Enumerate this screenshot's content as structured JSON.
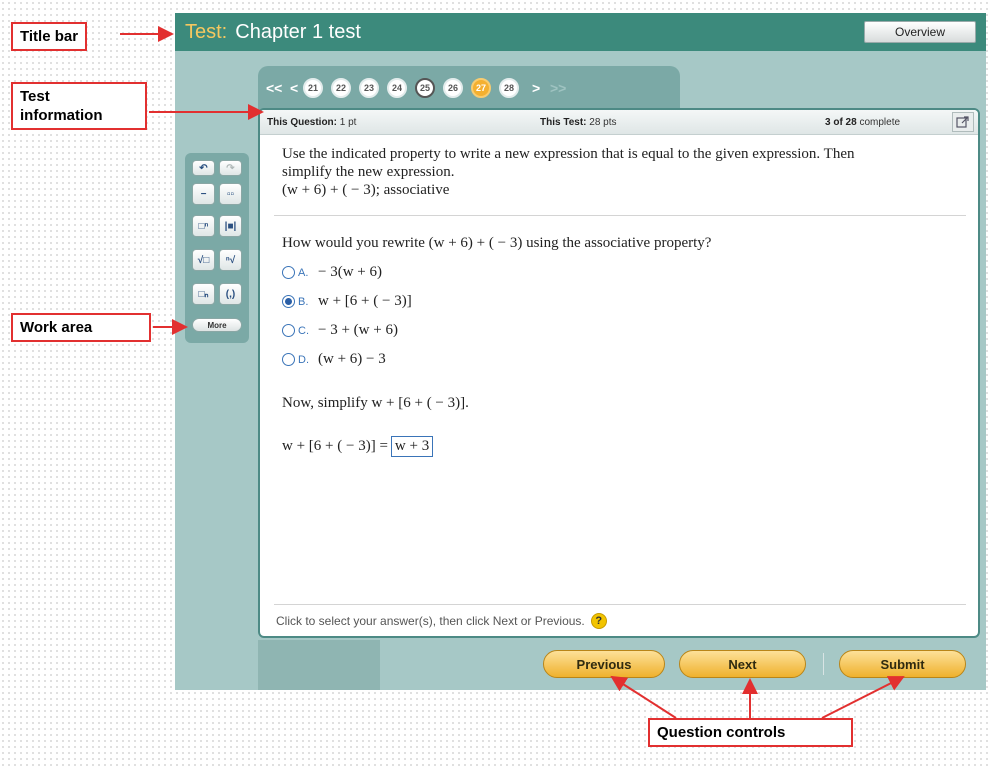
{
  "title_bar": {
    "prefix": "Test:",
    "name": "Chapter 1 test",
    "overview_label": "Overview"
  },
  "question_nav": {
    "first_label": "<<",
    "prev_label": "<",
    "next_label": ">",
    "last_label": ">>",
    "numbers": [
      "21",
      "22",
      "23",
      "24",
      "25",
      "26",
      "27",
      "28"
    ],
    "current": "25",
    "highlighted": "27"
  },
  "test_info": {
    "question_label": "This Question:",
    "question_value": "1 pt",
    "test_label": "This Test:",
    "test_value": "28 pts",
    "progress_strong": "3 of 28",
    "progress_suffix": "complete"
  },
  "question": {
    "prompt_line1": "Use the indicated property to write a new expression that is equal to the given expression. Then",
    "prompt_line2": "simplify the new expression.",
    "expression": "(w + 6) + ( − 3); associative",
    "ask": "How would you rewrite (w + 6) + ( − 3) using the associative property?",
    "options": [
      {
        "letter": "A.",
        "text": "− 3(w + 6)",
        "selected": false
      },
      {
        "letter": "B.",
        "text": "w + [6 + ( − 3)]",
        "selected": true
      },
      {
        "letter": "C.",
        "text": "− 3 + (w + 6)",
        "selected": false
      },
      {
        "letter": "D.",
        "text": "(w + 6) − 3",
        "selected": false
      }
    ],
    "simplify_prompt": "Now, simplify w + [6 + ( − 3)].",
    "answer_lhs": "w + [6 + ( − 3)] =",
    "answer_value": "w + 3"
  },
  "footer_hint": "Click to select your answer(s), then click Next or Previous.",
  "help_symbol": "?",
  "toolbar": {
    "buttons": [
      "undo-icon",
      "redo-icon",
      "fraction-icon",
      "mixed-number-icon",
      "exponent-icon",
      "absolute-value-icon",
      "square-root-icon",
      "nth-root-icon",
      "subscript-icon",
      "ordered-pair-icon"
    ],
    "more_label": "More"
  },
  "controls": {
    "previous_label": "Previous",
    "next_label": "Next",
    "submit_label": "Submit"
  },
  "callouts": {
    "title_bar": "Title bar",
    "test_info_line1": "Test",
    "test_info_line2": "information",
    "work_area": "Work area",
    "question_controls": "Question controls"
  },
  "colors": {
    "title_bar_bg": "#3c8a7c",
    "title_prefix": "#f5c860",
    "panel_bg": "#a6c8c6",
    "button_gold": "#efb12d",
    "callout_red": "#e23030",
    "highlight_question": "#f4b030"
  }
}
